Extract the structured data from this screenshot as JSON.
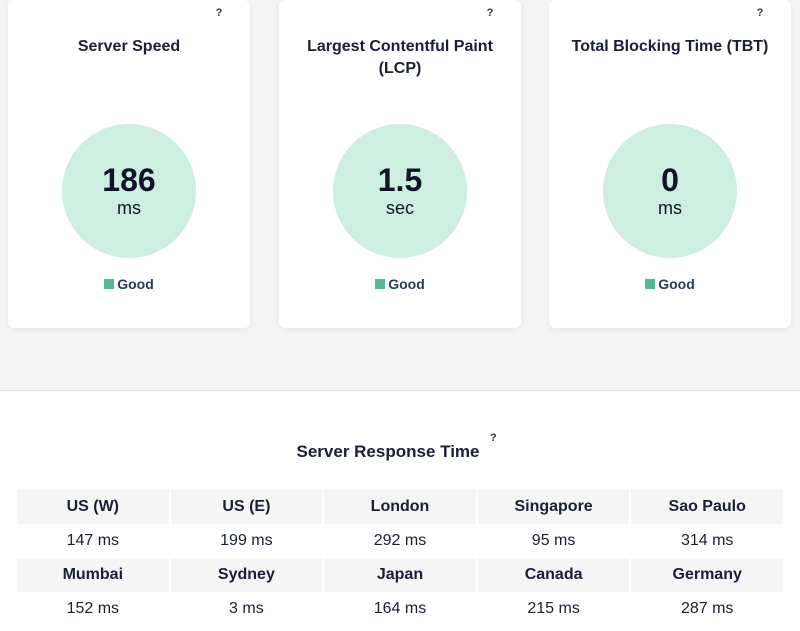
{
  "metrics": [
    {
      "title": "Server Speed",
      "value": "186",
      "unit": "ms",
      "status": "Good",
      "help": "?"
    },
    {
      "title": "Largest Contentful Paint (LCP)",
      "value": "1.5",
      "unit": "sec",
      "status": "Good",
      "help": "?"
    },
    {
      "title": "Total Blocking Time (TBT)",
      "value": "0",
      "unit": "ms",
      "status": "Good",
      "help": "?"
    }
  ],
  "server_response": {
    "heading": "Server Response Time",
    "help": "?",
    "rows": [
      {
        "locations": [
          "US (W)",
          "US (E)",
          "London",
          "Singapore",
          "Sao Paulo"
        ],
        "times": [
          "147 ms",
          "199 ms",
          "292 ms",
          "95 ms",
          "314 ms"
        ]
      },
      {
        "locations": [
          "Mumbai",
          "Sydney",
          "Japan",
          "Canada",
          "Germany"
        ],
        "times": [
          "152 ms",
          "3 ms",
          "164 ms",
          "215 ms",
          "287 ms"
        ]
      }
    ]
  },
  "colors": {
    "good": "#56b892",
    "circle": "#cdeee0"
  }
}
